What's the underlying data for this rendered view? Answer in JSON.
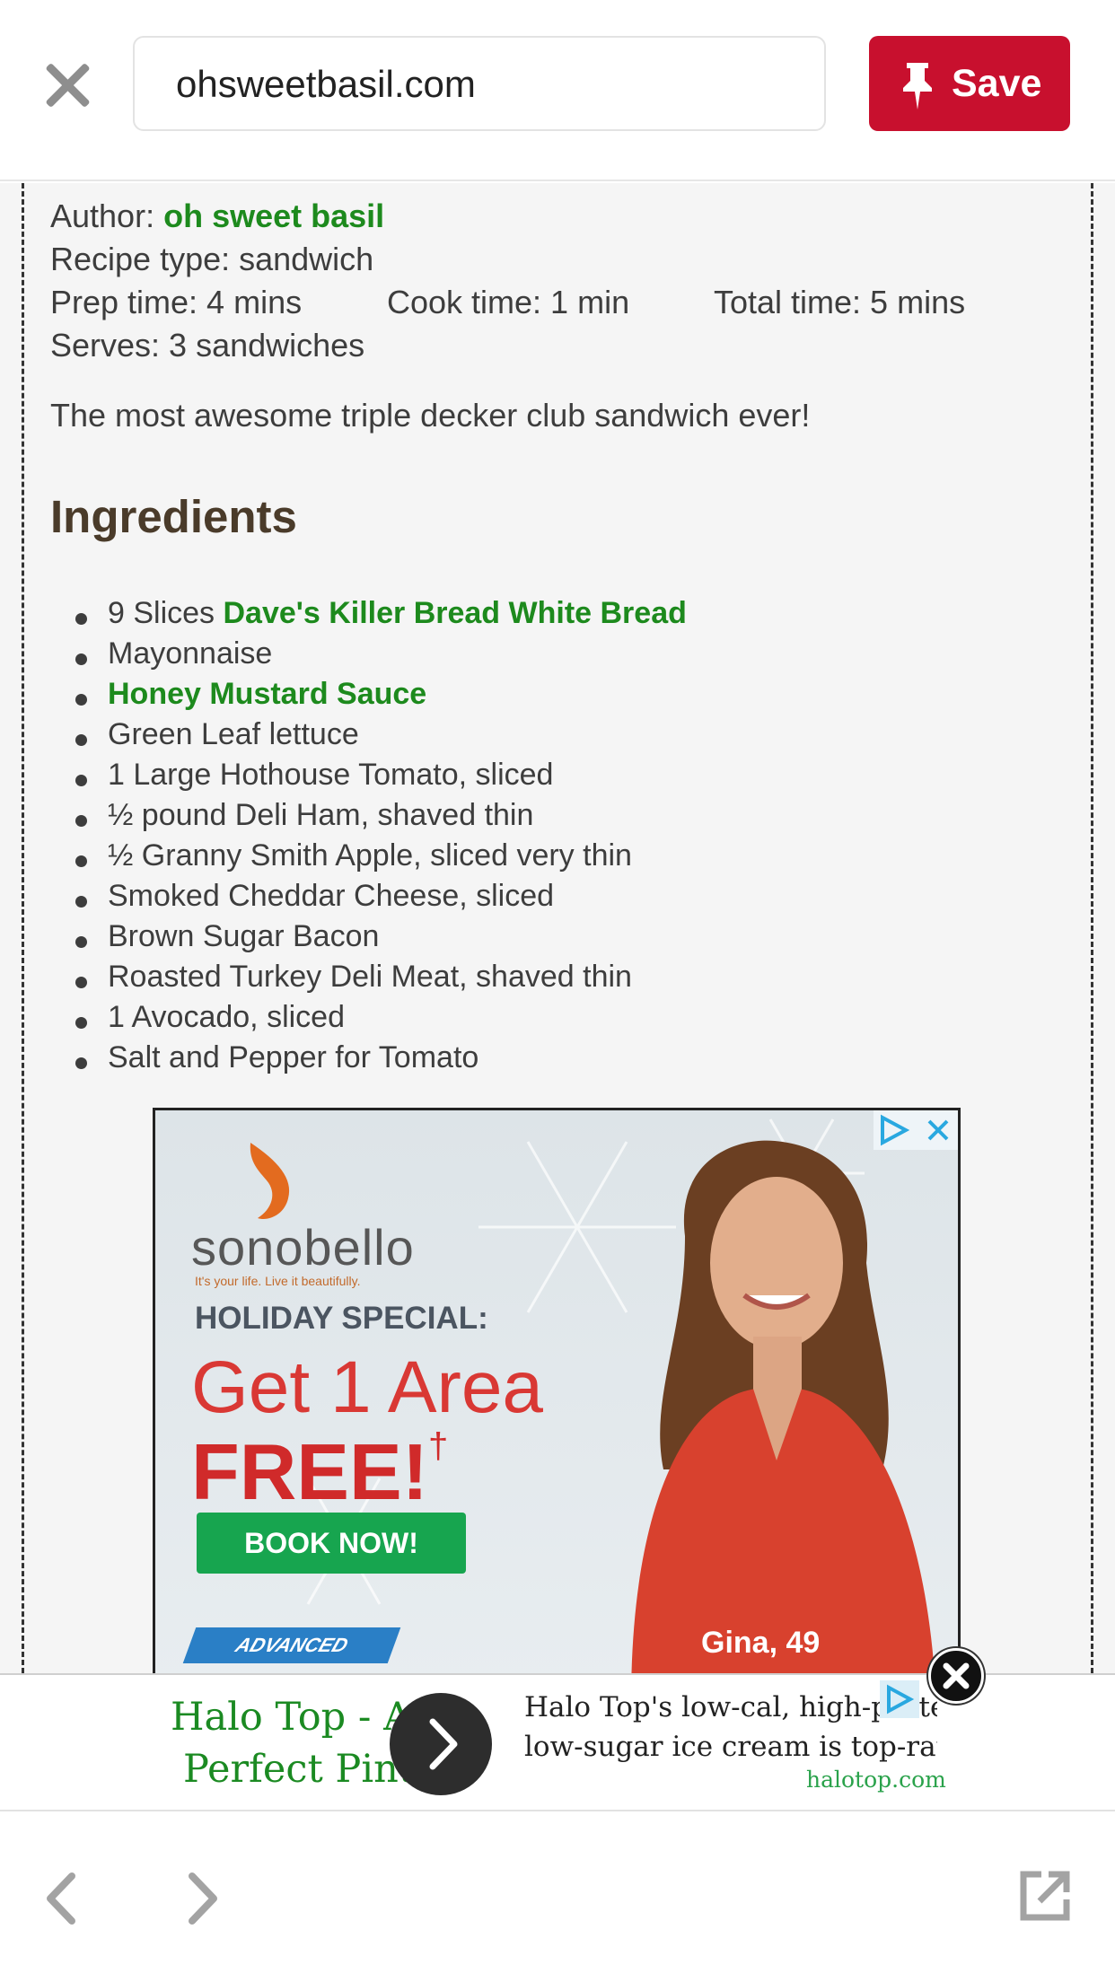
{
  "header": {
    "url": "ohsweetbasil.com",
    "save_label": "Save"
  },
  "recipe": {
    "author_label": "Author:",
    "author_name": "oh sweet basil",
    "type_label": "Recipe type: sandwich",
    "prep_label": "Prep time:  4 mins",
    "cook_label": "Cook time:  1 min",
    "total_label": "Total time:  5 mins",
    "serves_label": "Serves: 3 sandwiches",
    "summary": "The most awesome triple decker club sandwich ever!",
    "ingredients_heading": "Ingredients",
    "ingredients": [
      {
        "prefix": "9 Slices ",
        "link": "Dave's Killer Bread White Bread"
      },
      {
        "text": "Mayonnaise"
      },
      {
        "link": "Honey Mustard Sauce"
      },
      {
        "text": "Green Leaf lettuce"
      },
      {
        "text": "1 Large Hothouse Tomato, sliced"
      },
      {
        "text": "½ pound Deli Ham, shaved thin"
      },
      {
        "text": "½ Granny Smith Apple, sliced very thin"
      },
      {
        "text": "Smoked Cheddar Cheese, sliced"
      },
      {
        "text": "Brown Sugar Bacon"
      },
      {
        "text": "Roasted Turkey Deli Meat, shaved thin"
      },
      {
        "text": "1 Avocado, sliced"
      },
      {
        "text": "Salt and Pepper for Tomato"
      }
    ]
  },
  "ad": {
    "brand": "sonobello",
    "tagline": "It's your life. Live it beautifully.",
    "holiday": "HOLIDAY SPECIAL:",
    "headline": "Get 1 Area",
    "free": "FREE!",
    "free_mark": "†",
    "cta": "BOOK NOW!",
    "badge": "ADVANCED",
    "person_caption": "Gina, 49"
  },
  "bottom_ad": {
    "title_line1": "Halo Top - A",
    "title_line2": "Perfect Pint",
    "desc_line1": "Halo Top's low-cal, high-protein,",
    "desc_line2": "low-sugar ice cream is top-rated!",
    "domain": "halotop.com"
  },
  "icons": [
    "close-icon",
    "pin-icon",
    "adchoices-icon",
    "ad-close-icon",
    "chevron-right-icon",
    "back-icon",
    "forward-icon",
    "external-link-icon"
  ],
  "colors": {
    "save_red": "#c8102e",
    "link_green": "#1d8a1d",
    "heading_brown": "#4a3b2a"
  }
}
